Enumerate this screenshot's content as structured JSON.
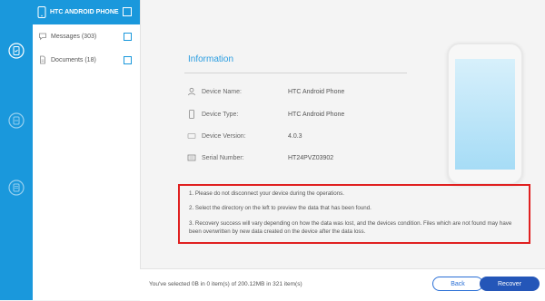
{
  "colors": {
    "accent": "#1a98dc",
    "highlight_box": "#e02020",
    "recover_button": "#2456b8"
  },
  "rail": {
    "icons": [
      {
        "name": "phone-restore-icon"
      },
      {
        "name": "itunes-restore-icon"
      },
      {
        "name": "icloud-restore-icon"
      }
    ]
  },
  "tree": {
    "device_label": "HTC ANDROID PHONE",
    "items": [
      {
        "label": "Messages (303)",
        "icon": "messages-icon"
      },
      {
        "label": "Documents (18)",
        "icon": "documents-icon"
      }
    ]
  },
  "info": {
    "title": "Information",
    "rows": [
      {
        "key": "Device Name:",
        "value": "HTC Android Phone",
        "icon": "user-icon"
      },
      {
        "key": "Device Type:",
        "value": "HTC Android Phone",
        "icon": "phone-icon"
      },
      {
        "key": "Device Version:",
        "value": "4.0.3",
        "icon": "device-icon"
      },
      {
        "key": "Serial Number:",
        "value": "HT24PVZ03902",
        "icon": "serial-icon"
      }
    ]
  },
  "notes": [
    "1. Please do not disconnect your device during the operations.",
    "2. Select the directory on the left to preview the data that has been found.",
    "3. Recovery success will vary depending on how the data was lost, and the devices condition. Files which are not found may have been overwritten by new data created on the device after the data loss."
  ],
  "footer": {
    "status": "You've selected 0B in 0 item(s) of 200.12MB in 321 item(s)",
    "back_label": "Back",
    "recover_label": "Recover"
  }
}
